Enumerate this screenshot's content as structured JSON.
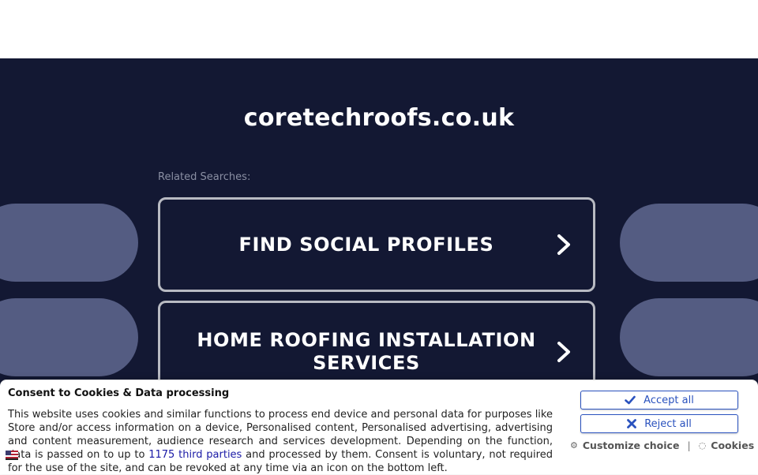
{
  "site": {
    "title": "coretechroofs.co.uk"
  },
  "related": {
    "label": "Related Searches:",
    "items": [
      {
        "label": "FIND SOCIAL PROFILES"
      },
      {
        "label": "HOME ROOFING INSTALLATION SERVICES"
      }
    ]
  },
  "consent": {
    "title": "Consent to Cookies & Data processing",
    "text_before": "This website uses cookies and similar functions to process end device and personal data for purposes like Store and/or access information on a device, Personalised content, Personalised advertising, advertising and content measurement, audience research and services development. Depending on the function, data is passed on to up to ",
    "link_text": "1175 third parties",
    "text_after": " and processed by them. Consent is voluntary, not required for the use of the site, and can be revoked at any time via an icon on the bottom left.",
    "accept_label": "Accept all",
    "reject_label": "Reject all",
    "customize_label": "Customize choice",
    "separator": "|",
    "cookies_label": "Cookies"
  },
  "colors": {
    "background": "#131833",
    "pill": "#545c82",
    "accent": "#2a52be"
  }
}
